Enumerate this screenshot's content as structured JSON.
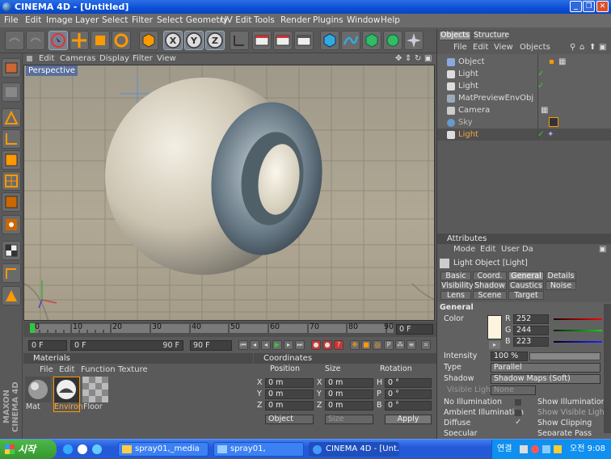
{
  "window": {
    "title": "CINEMA 4D - [Untitled]"
  },
  "menubar": [
    "File",
    "Edit",
    "Image",
    "Layer",
    "Select",
    "Filter",
    "Select Geometry",
    "UV Edit",
    "Tools",
    "Render",
    "Plugins",
    "Window",
    "Help"
  ],
  "viewport": {
    "menu": [
      "Edit",
      "Cameras",
      "Display",
      "Filter",
      "View"
    ],
    "label": "Perspective"
  },
  "timeline": {
    "ticks": [
      "0",
      "10",
      "20",
      "30",
      "40",
      "50",
      "60",
      "70",
      "80",
      "90"
    ],
    "current_frame": "0 F"
  },
  "playbar": {
    "start": "0 F",
    "min": "0 F",
    "max": "90 F",
    "end": "90 F"
  },
  "materials": {
    "title": "Materials",
    "menu": [
      "File",
      "Edit",
      "Function",
      "Texture"
    ],
    "items": [
      "Mat",
      "Environ",
      "Floor"
    ]
  },
  "coordinates": {
    "title": "Coordinates",
    "headers": [
      "Position",
      "Size",
      "Rotation"
    ],
    "rows": [
      {
        "axis": "X",
        "pos": "0 m",
        "size_axis": "X",
        "size": "0 m",
        "rot_axis": "H",
        "rot": "0 °"
      },
      {
        "axis": "Y",
        "pos": "0 m",
        "size_axis": "Y",
        "size": "0 m",
        "rot_axis": "P",
        "rot": "0 °"
      },
      {
        "axis": "Z",
        "pos": "0 m",
        "size_axis": "Z",
        "size": "0 m",
        "rot_axis": "B",
        "rot": "0 °"
      }
    ],
    "mode": "Object",
    "size_mode": "Size",
    "apply": "Apply"
  },
  "objects": {
    "tabs": [
      "Objects",
      "Structure"
    ],
    "menu": [
      "File",
      "Edit",
      "View",
      "Objects"
    ],
    "items": [
      "Object",
      "Light",
      "Light",
      "MatPreviewEnvObj",
      "Camera",
      "Sky",
      "Light"
    ]
  },
  "attributes": {
    "title": "Attributes",
    "menu": [
      "Mode",
      "Edit",
      "User Da"
    ],
    "object_title": "Light Object [Light]",
    "tabs": [
      "Basic",
      "Coord.",
      "General",
      "Details",
      "Visibility",
      "Shadow",
      "Caustics",
      "Noise",
      "Lens",
      "Scene",
      "Target"
    ],
    "section": "General",
    "color_label": "Color",
    "r": "252",
    "g": "244",
    "b": "223",
    "color_hex": "#fcf4df",
    "intensity_label": "Intensity",
    "intensity": "100 %",
    "type_label": "Type",
    "type": "Parallel",
    "shadow_label": "Shadow",
    "shadow": "Shadow Maps (Soft)",
    "visible_light_label": "Visible Light",
    "visible_light": "None",
    "checks": [
      "No Illumination",
      "Show Illumination",
      "Ambient Illumination",
      "Show Visible Ligh",
      "Diffuse",
      "Show Clipping",
      "Specular",
      "Separate Pass"
    ]
  },
  "taskbar": {
    "start": "시작",
    "tasks": [
      "spray01,_media",
      "spray01,",
      "CINEMA 4D - [Unt..."
    ],
    "tray_text": "연결",
    "clock": "오전 9:08"
  },
  "brand": "MAXON CINEMA 4D"
}
